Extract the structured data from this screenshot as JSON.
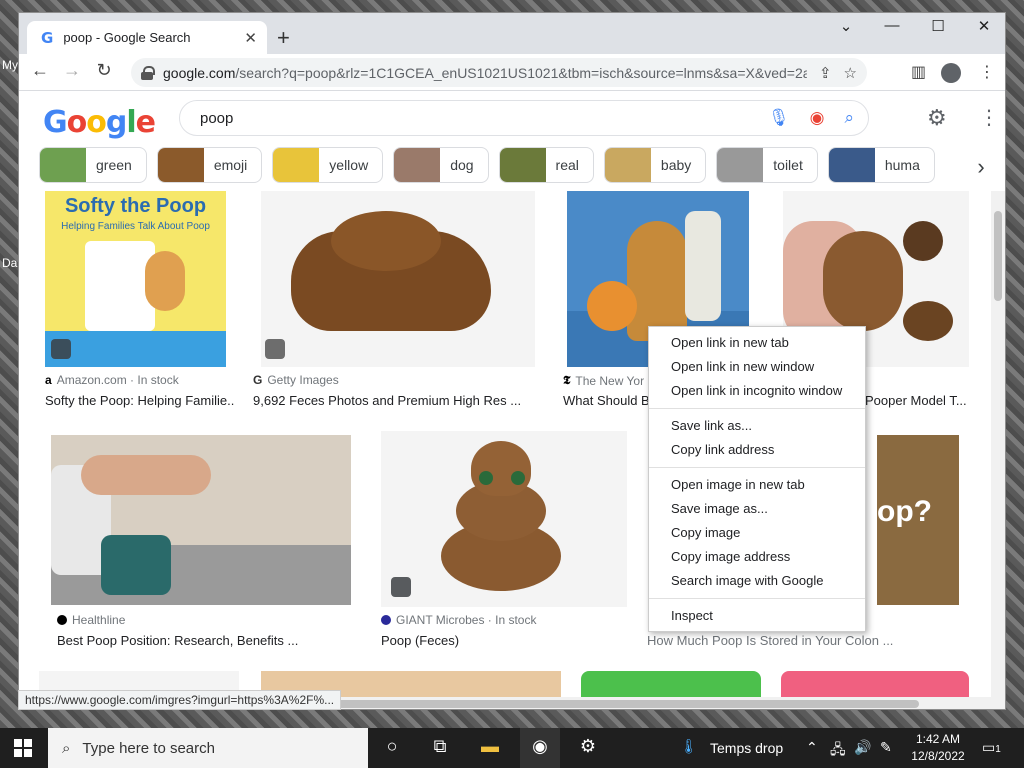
{
  "desktop": {
    "label_top": "My",
    "label_bottom": "Da"
  },
  "browser": {
    "tab_title": "poop - Google Search",
    "url_host": "google.com",
    "url_rest": "/search?q=poop&rlz=1C1GCEA_enUS1021US1021&tbm=isch&source=lnms&sa=X&ved=2ah...",
    "status_url": "https://www.google.com/imgres?imgurl=https%3A%2F%..."
  },
  "search": {
    "query": "poop",
    "logo": "Google"
  },
  "chips": [
    {
      "label": "green",
      "color": "#6ea050"
    },
    {
      "label": "emoji",
      "color": "#8b5a2b"
    },
    {
      "label": "yellow",
      "color": "#e8c43a"
    },
    {
      "label": "dog",
      "color": "#9a7a6a"
    },
    {
      "label": "real",
      "color": "#6b7a3a"
    },
    {
      "label": "baby",
      "color": "#c9a860"
    },
    {
      "label": "toilet",
      "color": "#999999"
    },
    {
      "label": "huma",
      "color": "#3a5a8a"
    }
  ],
  "results": [
    {
      "source": "Amazon.com · In stock",
      "caption": "Softy the Poop: Helping Familie...",
      "book_title": "Softy the Poop",
      "book_sub": "Helping Families Talk About Poop"
    },
    {
      "source": "Getty Images",
      "caption": "9,692 Feces Photos and Premium High Res ..."
    },
    {
      "source": "The New Yor",
      "caption": "What Should Ba"
    },
    {
      "source": "",
      "caption": "Pooper Model T..."
    },
    {
      "source": "Healthline",
      "caption": "Best Poop Position: Research, Benefits ..."
    },
    {
      "source": "GIANT Microbes · In stock",
      "caption": "Poop (Feces)"
    },
    {
      "source": "",
      "caption": "How Much Poop Is Stored in Your Colon ..."
    }
  ],
  "context_menu": {
    "group1": [
      "Open link in new tab",
      "Open link in new window",
      "Open link in incognito window"
    ],
    "group2": [
      "Save link as...",
      "Copy link address"
    ],
    "group3": [
      "Open image in new tab",
      "Save image as...",
      "Copy image",
      "Copy image address",
      "Search image with Google"
    ],
    "group4": [
      "Inspect"
    ]
  },
  "taskbar": {
    "search_placeholder": "Type here to search",
    "weather": "Temps drop",
    "time": "1:42 AM",
    "date": "12/8/2022",
    "notifications": "1"
  }
}
